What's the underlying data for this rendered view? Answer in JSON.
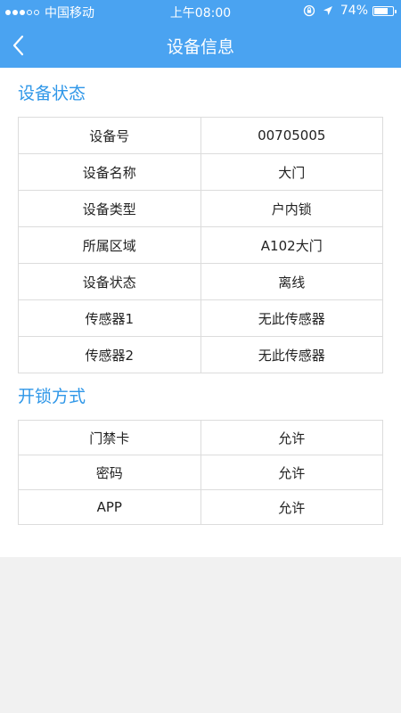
{
  "status_bar": {
    "carrier": "中国移动",
    "time": "上午08:00",
    "battery_text": "74%",
    "battery_level": 0.74,
    "signal": {
      "filled": 3,
      "total": 5
    }
  },
  "nav": {
    "title": "设备信息"
  },
  "device_status": {
    "title": "设备状态",
    "rows": [
      {
        "label": "设备号",
        "value": "00705005"
      },
      {
        "label": "设备名称",
        "value": "大门"
      },
      {
        "label": "设备类型",
        "value": "户内锁"
      },
      {
        "label": "所属区域",
        "value": "A102大门"
      },
      {
        "label": "设备状态",
        "value": "离线"
      },
      {
        "label": "传感器1",
        "value": "无此传感器"
      },
      {
        "label": "传感器2",
        "value": "无此传感器"
      }
    ]
  },
  "unlock_methods": {
    "title": "开锁方式",
    "rows": [
      {
        "label": "门禁卡",
        "value": "允许"
      },
      {
        "label": "密码",
        "value": "允许"
      },
      {
        "label": "APP",
        "value": "允许"
      }
    ]
  },
  "colors": {
    "header_bg": "#4aa3f1",
    "section_title": "#2f97e8",
    "table_border": "#dcdcdc",
    "page_bg": "#f1f1f1"
  }
}
